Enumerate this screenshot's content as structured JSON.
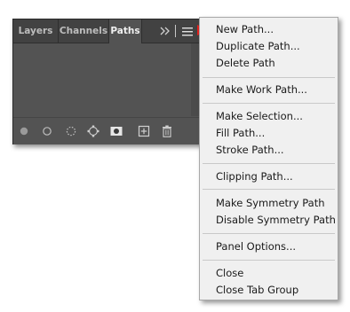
{
  "panel": {
    "tabs": [
      {
        "label": "Layers",
        "active": false
      },
      {
        "label": "Channels",
        "active": false
      },
      {
        "label": "Paths",
        "active": true
      }
    ],
    "collapse_icon": "double-chevron-right-icon",
    "menu_icon": "hamburger-menu-icon",
    "footer_icons": [
      "fill-path-icon",
      "stroke-path-icon",
      "load-path-as-selection-icon",
      "make-work-path-icon",
      "add-mask-icon",
      "create-new-path-icon",
      "delete-path-icon"
    ]
  },
  "menu": {
    "groups": [
      [
        "New Path...",
        "Duplicate Path...",
        "Delete Path"
      ],
      [
        "Make Work Path..."
      ],
      [
        "Make Selection...",
        "Fill Path...",
        "Stroke Path..."
      ],
      [
        "Clipping Path..."
      ],
      [
        "Make Symmetry Path",
        "Disable Symmetry Path"
      ],
      [
        "Panel Options..."
      ],
      [
        "Close",
        "Close Tab Group"
      ]
    ]
  },
  "colors": {
    "pointer_arrow": "#e8211d",
    "panel_bg": "#535353",
    "menu_bg": "#f0f0f0"
  }
}
